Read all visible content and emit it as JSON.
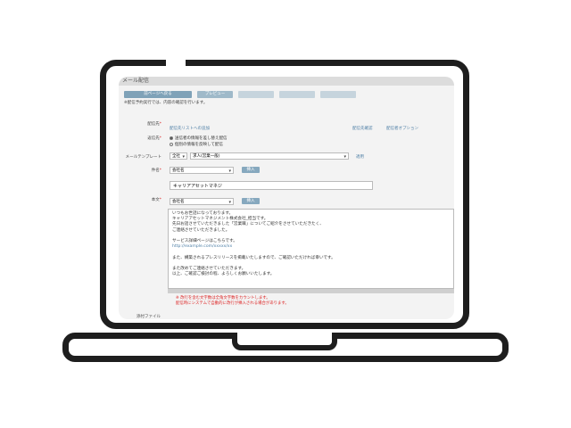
{
  "window": {
    "title": "メール配信"
  },
  "tabs": [
    {
      "label": "前ページへ戻る"
    },
    {
      "label": "プレビュー"
    },
    {
      "label": ""
    },
    {
      "label": ""
    },
    {
      "label": ""
    }
  ],
  "note": "※配信予約実行では、内容の確認を行います。",
  "form": {
    "recipient_label": "配信先",
    "recipient_link": "配信先リストへの追加",
    "recipient_right_link1": "配信先確認",
    "recipient_right_link2": "配信者オプション",
    "sender_label": "返信先",
    "sender_opt1": "送信者の情報を差し替え配信",
    "sender_opt2": "個別の情報を反映して配信",
    "template_label": "メールテンプレート",
    "template_select1": "全社",
    "template_select2": "求人(営業一般)",
    "template_side": "適用",
    "subject_label": "件名",
    "subject_select": "会社名",
    "subject_btn": "挿入",
    "subject_value": "キャリアアセットマネジ",
    "body_label": "本文",
    "body_select": "会社名",
    "body_btn": "挿入",
    "body_lines": [
      "いつもお世話になっております。",
      "キャリアアセットマネジメント株式会社_担当です。",
      "先日お話させていただきました「営業職」についてご紹介をさせていただきたく、",
      "ご連絡させていただきました。",
      "",
      "サービス詳細ページはこちらです。",
      "http://example.com/xxxxx/xx",
      "",
      "また、構築されるプレスリリースを掲載いたしますので、ご確認いただければ幸いです。",
      "",
      "また改めてご連絡させていただきます。",
      "以上、ご確認ご検討の程、よろしくお願いいたします。"
    ],
    "warn_line1": "※ 改行を含む文字数は全角文字数をカウントします。",
    "warn_line2": "配信時にシステムで自動的に改行が挿入される場合があります。",
    "attach_label": "添付ファイル"
  },
  "colors": {
    "frame": "#1e1e1e",
    "accent": "#86a8be",
    "warning": "#dd2222",
    "link": "#4e7fa6"
  }
}
